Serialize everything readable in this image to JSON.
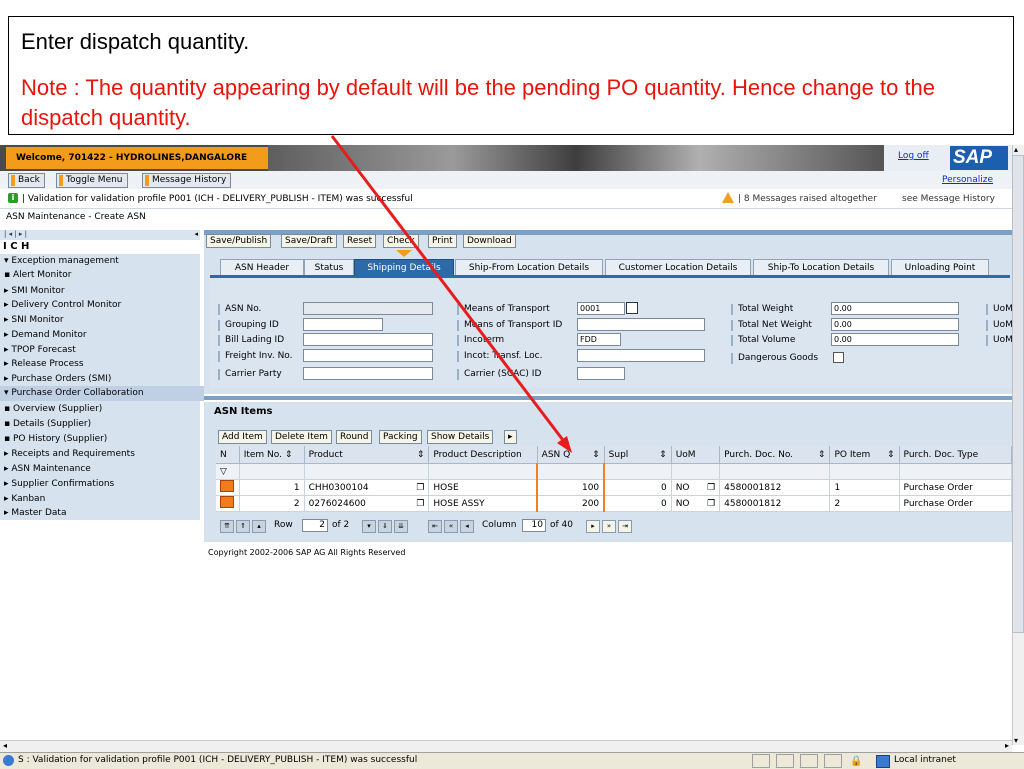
{
  "callout": {
    "instruction": "Enter dispatch quantity.",
    "note": "Note : The quantity appearing by default will be the pending PO quantity. Hence change to the dispatch quantity."
  },
  "header": {
    "welcome": "Welcome, 701422 - HYDROLINES,DANGALORE",
    "logoff": "Log off",
    "logo": "SAP",
    "personalize": "Personalize"
  },
  "toolbar": {
    "back": "Back",
    "toggle_menu": "Toggle Menu",
    "message_history": "Message History"
  },
  "messages": {
    "success": "Validation for validation profile P001 (ICH - DELIVERY_PUBLISH - ITEM) was successful",
    "warning": "8 Messages raised altogether",
    "see_history": "see Message History"
  },
  "breadcrumb": "ASN Maintenance - Create ASN",
  "nav": {
    "pager": "| ◂ | ▸ |",
    "title": "I C H",
    "items": [
      {
        "label": "▾ Exception management"
      },
      {
        "label": "    ▪ Alert Monitor"
      },
      {
        "label": "▸ SMI Monitor"
      },
      {
        "label": "▸ Delivery Control Monitor"
      },
      {
        "label": "▸ SNI Monitor"
      },
      {
        "label": "▸ Demand Monitor"
      },
      {
        "label": "▸ TPOP Forecast"
      },
      {
        "label": "▸ Release Process"
      },
      {
        "label": "▸ Purchase Orders (SMI)"
      },
      {
        "label": "▾ Purchase Order Collaboration"
      },
      {
        "label": "    ▪ Overview (Supplier)"
      },
      {
        "label": "    ▪ Details (Supplier)"
      },
      {
        "label": "    ▪ PO History (Supplier)"
      },
      {
        "label": "▸ Receipts and Requirements"
      },
      {
        "label": "▸ ASN Maintenance"
      },
      {
        "label": "▸ Supplier Confirmations"
      },
      {
        "label": "▸ Kanban"
      },
      {
        "label": "▸ Master Data"
      }
    ]
  },
  "actions": {
    "save_publish": "Save/Publish",
    "save_draft": "Save/Draft",
    "reset": "Reset",
    "check": "Check",
    "print": "Print",
    "download": "Download"
  },
  "tabs": [
    "ASN Header",
    "Status",
    "Shipping Details",
    "Ship-From Location Details",
    "Customer Location Details",
    "Ship-To Location Details",
    "Unloading Point"
  ],
  "form": {
    "asn_no": "ASN No.",
    "grouping_id": "Grouping ID",
    "bill_lading_id": "Bill Lading ID",
    "freight_inv_no": "Freight Inv. No.",
    "carrier_party": "Carrier Party",
    "means_transport": "Means of Transport",
    "means_transport_value": "0001",
    "means_transport_id": "Means of Transport ID",
    "incoterm": "Incoterm",
    "incoterm_value": "FDD",
    "incot_transf_loc": "Incot: Transf. Loc.",
    "carrier_scac": "Carrier (SCAC) ID",
    "total_weight": "Total Weight",
    "total_weight_value": "0.00",
    "total_net_weight": "Total Net Weight",
    "total_net_weight_value": "0.00",
    "total_volume": "Total Volume",
    "total_volume_value": "0.00",
    "dangerous_goods": "Dangerous Goods",
    "uom": "UoM"
  },
  "items": {
    "title": "ASN Items",
    "buttons": {
      "add": "Add Item",
      "delete": "Delete Item",
      "round": "Round",
      "packing": "Packing",
      "show_details": "Show Details"
    },
    "columns": [
      "N",
      "Item No.",
      "Product",
      "Product Description",
      "ASN Q",
      "Supl",
      "UoM",
      "Purch. Doc. No.",
      "PO Item",
      "Purch. Doc. Type"
    ],
    "rows": [
      {
        "item_no": "1",
        "product": "CHH0300104",
        "description": "HOSE",
        "asn_qty": "100",
        "supl": "0",
        "uom": "NO",
        "po_no": "4580001812",
        "po_item": "1",
        "doc_type": "Purchase Order"
      },
      {
        "item_no": "2",
        "product": "0276024600",
        "description": "HOSE ASSY",
        "asn_qty": "200",
        "supl": "0",
        "uom": "NO",
        "po_no": "4580001812",
        "po_item": "2",
        "doc_type": "Purchase Order"
      }
    ],
    "pager": {
      "row_label": "Row",
      "row": "2",
      "row_of": "of 2",
      "col_label": "Column",
      "col": "10",
      "col_of": "of 40"
    }
  },
  "copyright": "Copyright 2002-2006 SAP AG All Rights Reserved",
  "statusbar": {
    "text": "S : Validation for validation profile P001 (ICH - DELIVERY_PUBLISH - ITEM) was successful",
    "zone": "Local intranet"
  },
  "colors": {
    "accent": "#f39c1c",
    "tab_active": "#2e6aa8",
    "note": "#e8140c",
    "arrow": "#e81c1c"
  }
}
